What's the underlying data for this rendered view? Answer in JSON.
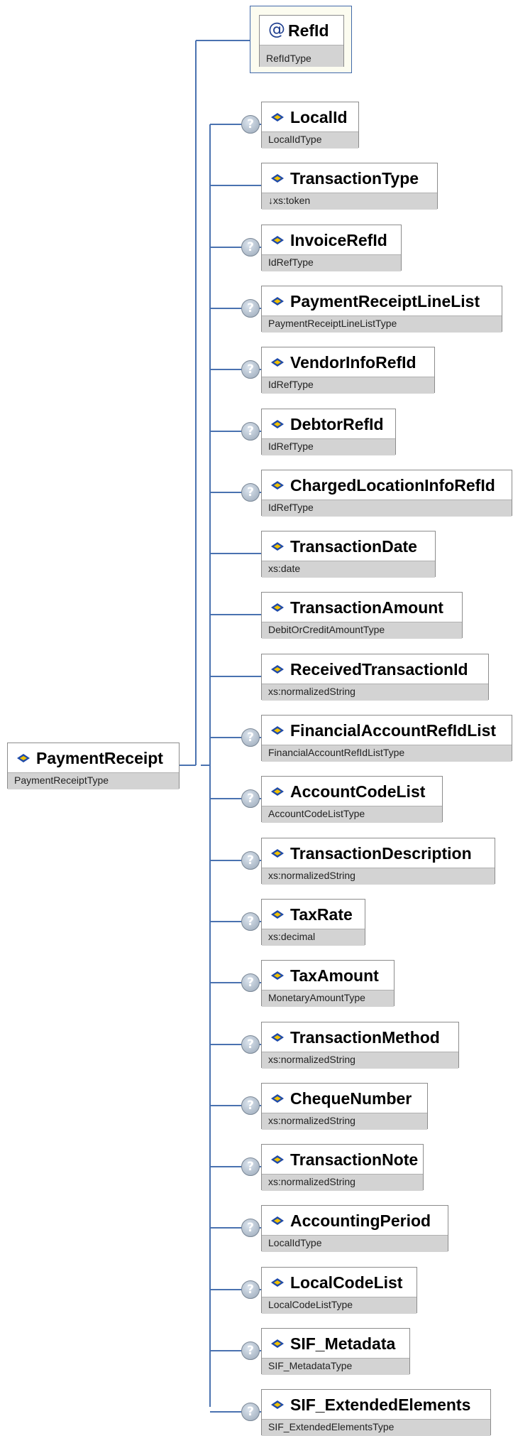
{
  "root": {
    "name": "PaymentReceipt",
    "type": "PaymentReceiptType"
  },
  "attribute": {
    "name": "RefId",
    "type": "RefIdType",
    "marker": "@"
  },
  "optional_marker": "?",
  "children": [
    {
      "name": "LocalId",
      "type": "LocalIdType",
      "optional": true
    },
    {
      "name": "TransactionType",
      "type": "↓xs:token",
      "optional": false
    },
    {
      "name": "InvoiceRefId",
      "type": "IdRefType",
      "optional": true
    },
    {
      "name": "PaymentReceiptLineList",
      "type": "PaymentReceiptLineListType",
      "optional": true
    },
    {
      "name": "VendorInfoRefId",
      "type": "IdRefType",
      "optional": true
    },
    {
      "name": "DebtorRefId",
      "type": "IdRefType",
      "optional": true
    },
    {
      "name": "ChargedLocationInfoRefId",
      "type": "IdRefType",
      "optional": true
    },
    {
      "name": "TransactionDate",
      "type": "xs:date",
      "optional": false
    },
    {
      "name": "TransactionAmount",
      "type": "DebitOrCreditAmountType",
      "optional": false
    },
    {
      "name": "ReceivedTransactionId",
      "type": "xs:normalizedString",
      "optional": false
    },
    {
      "name": "FinancialAccountRefIdList",
      "type": "FinancialAccountRefIdListType",
      "optional": true
    },
    {
      "name": "AccountCodeList",
      "type": "AccountCodeListType",
      "optional": true
    },
    {
      "name": "TransactionDescription",
      "type": "xs:normalizedString",
      "optional": true
    },
    {
      "name": "TaxRate",
      "type": "xs:decimal",
      "optional": true
    },
    {
      "name": "TaxAmount",
      "type": "MonetaryAmountType",
      "optional": true
    },
    {
      "name": "TransactionMethod",
      "type": "xs:normalizedString",
      "optional": true
    },
    {
      "name": "ChequeNumber",
      "type": "xs:normalizedString",
      "optional": true
    },
    {
      "name": "TransactionNote",
      "type": "xs:normalizedString",
      "optional": true
    },
    {
      "name": "AccountingPeriod",
      "type": "LocalIdType",
      "optional": true
    },
    {
      "name": "LocalCodeList",
      "type": "LocalCodeListType",
      "optional": true
    },
    {
      "name": "SIF_Metadata",
      "type": "SIF_MetadataType",
      "optional": true
    },
    {
      "name": "SIF_ExtendedElements",
      "type": "SIF_ExtendedElementsType",
      "optional": true
    }
  ],
  "colors": {
    "connector": "#4a72b0",
    "type_band": "#d3d3d3",
    "border": "#8c8c8c",
    "attribute_border": "#4169aa",
    "element_icon_blue": "#1f4aa8",
    "element_icon_yellow": "#f2c200"
  }
}
